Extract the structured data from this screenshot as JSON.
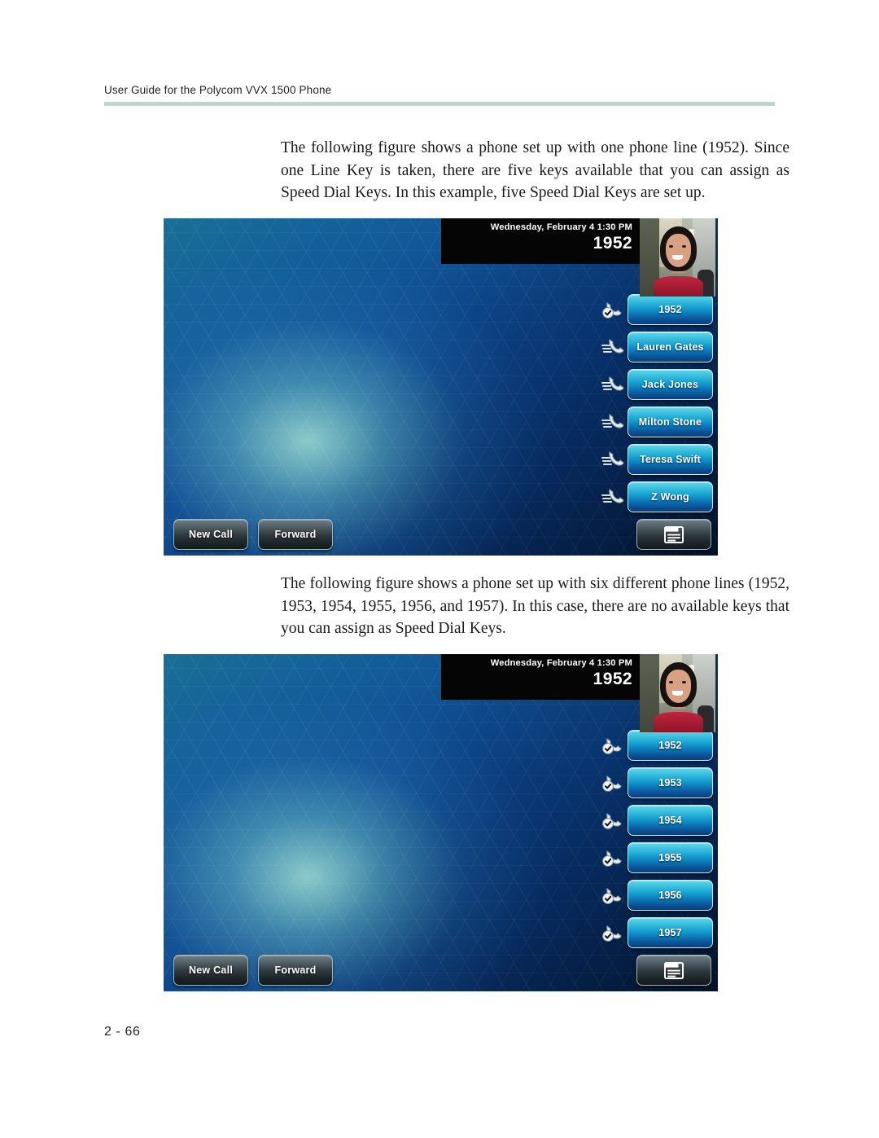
{
  "document": {
    "header_title": "User Guide for the Polycom VVX 1500 Phone",
    "page_number": "2 - 66",
    "rule_color": "#bdd3cf"
  },
  "paragraphs": {
    "first": "The following figure shows a phone set up with one phone line (1952). Since one Line Key is taken, there are five keys available that you can assign as Speed Dial Keys. In this example, five Speed Dial Keys are set up.",
    "second": "The following figure shows a phone set up with six different phone lines (1952, 1953, 1954, 1955, 1956, and 1957). In this case, there are no available keys that you can assign as Speed Dial Keys."
  },
  "figures": [
    {
      "id": "phone-screen-one-line",
      "statusbar": {
        "datetime": "Wednesday, February 4  1:30 PM",
        "line_number": "1952"
      },
      "selfview": {
        "label": "video-self-view"
      },
      "line_keys": [
        {
          "label": "1952",
          "icon": "handset-registered-icon",
          "type": "line"
        },
        {
          "label": "Lauren Gates",
          "icon": "handset-speeddial-icon",
          "type": "speed-dial"
        },
        {
          "label": "Jack Jones",
          "icon": "handset-speeddial-icon",
          "type": "speed-dial"
        },
        {
          "label": "Milton Stone",
          "icon": "handset-speeddial-icon",
          "type": "speed-dial"
        },
        {
          "label": "Teresa Swift",
          "icon": "handset-speeddial-icon",
          "type": "speed-dial"
        },
        {
          "label": "Z Wong",
          "icon": "handset-speeddial-icon",
          "type": "speed-dial"
        }
      ],
      "soft_keys": {
        "new_call": "New Call",
        "forward": "Forward",
        "menu_icon": "applications-menu-icon"
      }
    },
    {
      "id": "phone-screen-six-lines",
      "statusbar": {
        "datetime": "Wednesday, February 4  1:30 PM",
        "line_number": "1952"
      },
      "selfview": {
        "label": "video-self-view"
      },
      "line_keys": [
        {
          "label": "1952",
          "icon": "handset-registered-icon",
          "type": "line"
        },
        {
          "label": "1953",
          "icon": "handset-registered-icon",
          "type": "line"
        },
        {
          "label": "1954",
          "icon": "handset-registered-icon",
          "type": "line"
        },
        {
          "label": "1955",
          "icon": "handset-registered-icon",
          "type": "line"
        },
        {
          "label": "1956",
          "icon": "handset-registered-icon",
          "type": "line"
        },
        {
          "label": "1957",
          "icon": "handset-registered-icon",
          "type": "line"
        }
      ],
      "soft_keys": {
        "new_call": "New Call",
        "forward": "Forward",
        "menu_icon": "applications-menu-icon"
      }
    }
  ],
  "colors": {
    "line_key_accent": "#159fd0",
    "soft_key": "#2f3a3f",
    "status_bar": "#050505",
    "header_rule": "#bdd3cf"
  }
}
